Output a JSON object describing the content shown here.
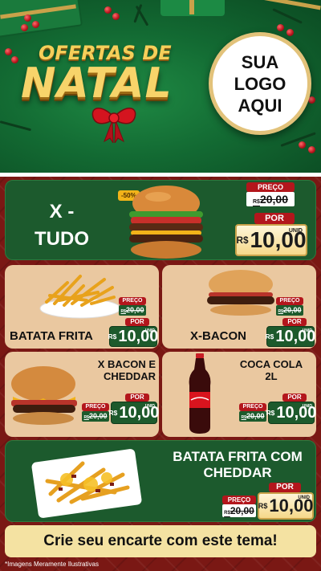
{
  "header": {
    "title_top": "OFERTAS DE",
    "title_main": "NATAL",
    "logo_lines": [
      "SUA",
      "LOGO",
      "AQUI"
    ]
  },
  "products": {
    "xtudo": {
      "name_line1": "X -",
      "name_line2": "TUDO",
      "badge": "-50%",
      "preco_label": "PREÇO",
      "old_price": "20,00",
      "old_prefix": "R$",
      "por_label": "POR",
      "currency": "R$",
      "new_price": "10,00",
      "unit": "UNID"
    },
    "batata": {
      "name": "BATATA FRITA",
      "preco_label": "PREÇO",
      "old_price": "20,00",
      "old_prefix": "R$",
      "por_label": "POR",
      "currency": "R$",
      "new_price": "10,00",
      "unit": "UNID"
    },
    "xbacon": {
      "name": "X-BACON",
      "preco_label": "PREÇO",
      "old_price": "20,00",
      "old_prefix": "R$",
      "por_label": "POR",
      "currency": "R$",
      "new_price": "10,00",
      "unit": "UNID"
    },
    "xbaconcheddar": {
      "name_line1": "X BACON E",
      "name_line2": "CHEDDAR",
      "preco_label": "PREÇO",
      "old_price": "20,00",
      "old_prefix": "R$",
      "por_label": "POR",
      "currency": "R$",
      "new_price": "10,00",
      "unit": "UNID"
    },
    "coca": {
      "name_line1": "COCA COLA",
      "name_line2": "2L",
      "preco_label": "PREÇO",
      "old_price": "20,00",
      "old_prefix": "R$",
      "por_label": "POR",
      "currency": "R$",
      "new_price": "10,00",
      "unit": "UNID"
    },
    "batatacheddar": {
      "name_line1": "BATATA FRITA COM",
      "name_line2": "CHEDDAR",
      "preco_label": "PREÇO",
      "old_price": "20,00",
      "old_prefix": "R$",
      "por_label": "POR",
      "currency": "R$",
      "new_price": "10,00",
      "unit": "UNID"
    }
  },
  "footer": {
    "cta": "Crie seu encarte com este tema!",
    "disclaimer": "*Imagens Meramente Ilustrativas"
  },
  "colors": {
    "dark_red": "#7a1814",
    "green_card": "#1c5a2d",
    "beige_card": "#eac8a0",
    "price_red": "#b3161c",
    "gold": "#f7d46a"
  }
}
